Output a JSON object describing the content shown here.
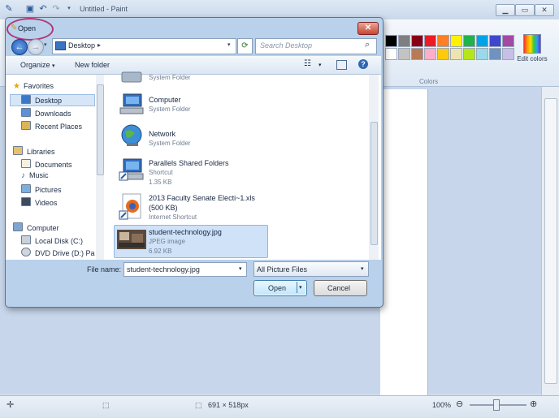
{
  "paint": {
    "title": "Untitled - Paint",
    "colors_group_label": "Colors",
    "edit_colors_label": "Edit colors",
    "status_size": "691 × 518px",
    "zoom": "100%",
    "palette_row1": [
      "#000000",
      "#7f7f7f",
      "#880015",
      "#ed1c24",
      "#ff7f27",
      "#fff200",
      "#22b14c",
      "#00a2e8",
      "#3f48cc",
      "#a349a4"
    ],
    "palette_row2": [
      "#ffffff",
      "#c3c3c3",
      "#b97a57",
      "#ffaec9",
      "#ffc90e",
      "#efe4b0",
      "#b5e61d",
      "#99d9ea",
      "#7092be",
      "#c8bfe7"
    ]
  },
  "dialog": {
    "title": "Open",
    "address": "Desktop",
    "search_placeholder": "Search Desktop",
    "toolbar": {
      "organize": "Organize",
      "new_folder": "New folder"
    },
    "nav": {
      "favorites": "Favorites",
      "desktop": "Desktop",
      "downloads": "Downloads",
      "recent_places": "Recent Places",
      "libraries": "Libraries",
      "documents": "Documents",
      "music": "Music",
      "pictures": "Pictures",
      "videos": "Videos",
      "computer": "Computer",
      "local_disk": "Local Disk (C:)",
      "dvd_drive": "DVD Drive (D:) Pa"
    },
    "files": [
      {
        "name": "",
        "meta1": "System Folder",
        "meta2": ""
      },
      {
        "name": "Computer",
        "meta1": "System Folder",
        "meta2": ""
      },
      {
        "name": "Network",
        "meta1": "System Folder",
        "meta2": ""
      },
      {
        "name": "Parallels Shared Folders",
        "meta1": "Shortcut",
        "meta2": "1.35 KB"
      },
      {
        "name": "2013 Faculty Senate Electi~1.xls",
        "meta1": "(500 KB)",
        "meta2": "Internet Shortcut"
      },
      {
        "name": "student-technology.jpg",
        "meta1": "JPEG image",
        "meta2": "6.92 KB"
      }
    ],
    "file_name_label": "File name:",
    "file_name_value": "student-technology.jpg",
    "file_type_value": "All Picture Files",
    "open_button": "Open",
    "cancel_button": "Cancel"
  }
}
